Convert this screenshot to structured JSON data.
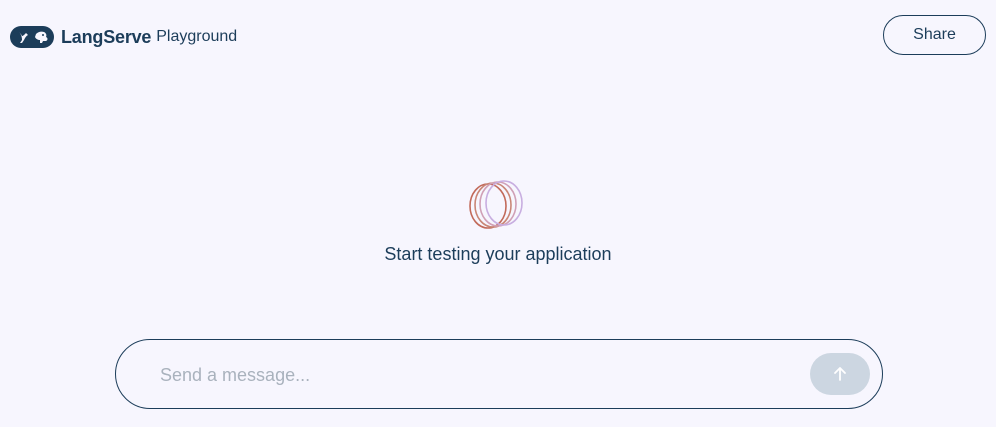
{
  "header": {
    "brand": "LangServe",
    "brand_sub": "Playground",
    "share_label": "Share"
  },
  "empty_state": {
    "message": "Start testing your application"
  },
  "composer": {
    "placeholder": "Send a message...",
    "value": ""
  },
  "icons": {
    "logo": "langchain-logo-icon",
    "empty": "rings-logo-icon",
    "send": "arrow-up-icon"
  },
  "colors": {
    "background": "#f7f6fe",
    "text": "#1c3d5a",
    "send_button": "#ccd6e1",
    "ring_warm": "#c26a5a",
    "ring_cool": "#c8aee0"
  }
}
